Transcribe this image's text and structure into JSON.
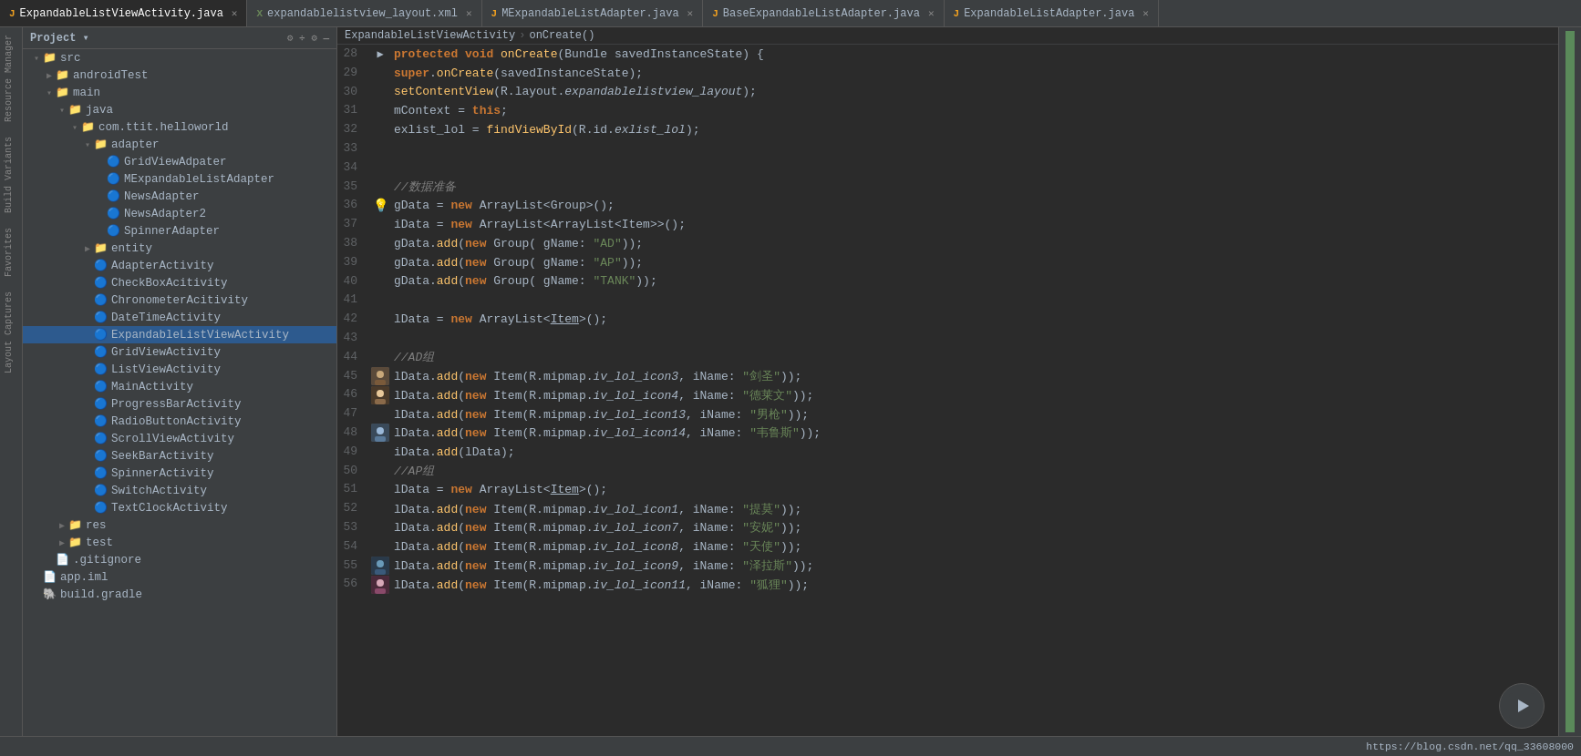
{
  "tabs": [
    {
      "id": "tab1",
      "label": "ExpandableListViewActivity.java",
      "type": "java",
      "active": true
    },
    {
      "id": "tab2",
      "label": "expandablelistview_layout.xml",
      "type": "xml",
      "active": false
    },
    {
      "id": "tab3",
      "label": "MExpandableListAdapter.java",
      "type": "java",
      "active": false
    },
    {
      "id": "tab4",
      "label": "BaseExpandableListAdapter.java",
      "type": "java",
      "active": false
    },
    {
      "id": "tab5",
      "label": "ExpandableListAdapter.java",
      "type": "java",
      "active": false
    }
  ],
  "sidebar": {
    "title": "Project",
    "items": [
      {
        "level": 1,
        "type": "folder",
        "label": "src",
        "expanded": true
      },
      {
        "level": 2,
        "type": "folder",
        "label": "androidTest",
        "expanded": false
      },
      {
        "level": 2,
        "type": "folder",
        "label": "main",
        "expanded": true
      },
      {
        "level": 3,
        "type": "folder",
        "label": "java",
        "expanded": true
      },
      {
        "level": 4,
        "type": "folder",
        "label": "com.ttit.helloworld",
        "expanded": true
      },
      {
        "level": 5,
        "type": "folder",
        "label": "adapter",
        "expanded": true
      },
      {
        "level": 6,
        "type": "java",
        "label": "GridViewAdpater"
      },
      {
        "level": 6,
        "type": "java",
        "label": "MExpandableListAdapter"
      },
      {
        "level": 6,
        "type": "java",
        "label": "NewsAdapter"
      },
      {
        "level": 6,
        "type": "java",
        "label": "NewsAdapter2"
      },
      {
        "level": 6,
        "type": "java",
        "label": "SpinnerAdapter"
      },
      {
        "level": 5,
        "type": "folder",
        "label": "entity",
        "expanded": false
      },
      {
        "level": 5,
        "type": "java",
        "label": "AdapterActivity"
      },
      {
        "level": 5,
        "type": "java",
        "label": "CheckBoxAcitivity"
      },
      {
        "level": 5,
        "type": "java",
        "label": "ChronometerAcitivity"
      },
      {
        "level": 5,
        "type": "java",
        "label": "DateTimeActivity"
      },
      {
        "level": 5,
        "type": "java",
        "label": "ExpandableListViewActivity",
        "selected": true
      },
      {
        "level": 5,
        "type": "java",
        "label": "GridViewActivity"
      },
      {
        "level": 5,
        "type": "java",
        "label": "ListViewActivity"
      },
      {
        "level": 5,
        "type": "java",
        "label": "MainActivity"
      },
      {
        "level": 5,
        "type": "java",
        "label": "ProgressBarActivity"
      },
      {
        "level": 5,
        "type": "java",
        "label": "RadioButtonActivity"
      },
      {
        "level": 5,
        "type": "java",
        "label": "ScrollViewActivity"
      },
      {
        "level": 5,
        "type": "java",
        "label": "SeekBarActivity"
      },
      {
        "level": 5,
        "type": "java",
        "label": "SpinnerActivity"
      },
      {
        "level": 5,
        "type": "java",
        "label": "SwitchActivity"
      },
      {
        "level": 5,
        "type": "java",
        "label": "TextClockActivity"
      },
      {
        "level": 3,
        "type": "folder",
        "label": "res",
        "expanded": false
      },
      {
        "level": 3,
        "type": "folder",
        "label": "test",
        "expanded": false
      },
      {
        "level": 2,
        "type": "git",
        "label": ".gitignore"
      },
      {
        "level": 1,
        "type": "iml",
        "label": "app.iml"
      },
      {
        "level": 1,
        "type": "gradle",
        "label": "build.gradle"
      }
    ]
  },
  "code": {
    "lines": [
      {
        "num": 28,
        "content": "protected",
        "raw": "    <kw>protected</kw> <kw>void</kw> <method>onCreate</method>(<type>Bundle</type> <param>savedInstanceState</param>) {",
        "gutter": "arrow"
      },
      {
        "num": 29,
        "content": "",
        "raw": "        <kw>super</kw>.<method>onCreate</method>(<param>savedInstanceState</param>);"
      },
      {
        "num": 30,
        "content": "",
        "raw": "        <method>setContentView</method>(<type>R</type>.layout.<italic-type>expandablelistview_layout</italic-type>);"
      },
      {
        "num": 31,
        "content": "",
        "raw": "        mContext = <kw>this</kw>;"
      },
      {
        "num": 32,
        "content": "",
        "raw": "        exlist_lol = <method>findViewById</method>(<type>R</type>.id.<italic-type>exlist_lol</italic-type>);"
      },
      {
        "num": 33,
        "content": "",
        "raw": ""
      },
      {
        "num": 34,
        "content": "",
        "raw": ""
      },
      {
        "num": 35,
        "content": "",
        "raw": "        <comment>//数据准备</comment>"
      },
      {
        "num": 36,
        "content": "",
        "raw": "        gData = <kw>new</kw> <type>ArrayList</type>&lt;<type>Group</type>&gt;();",
        "gutter": "bulb"
      },
      {
        "num": 37,
        "content": "",
        "raw": "        iData = <kw>new</kw> <type>ArrayList</type>&lt;<type>ArrayList</type>&lt;<type>Item</type>&gt;&gt;();"
      },
      {
        "num": 38,
        "content": "",
        "raw": "        gData.<method>add</method>(<kw>new</kw> <type>Group</type>( gName: <string>\"AD\"</string>));"
      },
      {
        "num": 39,
        "content": "",
        "raw": "        gData.<method>add</method>(<kw>new</kw> <type>Group</type>( gName: <string>\"AP\"</string>));"
      },
      {
        "num": 40,
        "content": "",
        "raw": "        gData.<method>add</method>(<kw>new</kw> <type>Group</type>( gName: <string>\"TANK\"</string>));"
      },
      {
        "num": 41,
        "content": "",
        "raw": ""
      },
      {
        "num": 42,
        "content": "",
        "raw": "        lData = <kw>new</kw> <type>ArrayList</type>&lt;<type>Item</type>&gt;();"
      },
      {
        "num": 43,
        "content": "",
        "raw": ""
      },
      {
        "num": 44,
        "content": "",
        "raw": "        <comment>//AD组</comment>"
      },
      {
        "num": 45,
        "content": "",
        "raw": "        lData.<method>add</method>(<kw>new</kw> <type>Item</type>(<type>R</type>.mipmap.<italic-type>iv_lol_icon3</italic-type>,  iName: <string>\"剑圣\"</string>));",
        "gutter": "thumb"
      },
      {
        "num": 46,
        "content": "",
        "raw": "        lData.<method>add</method>(<kw>new</kw> <type>Item</type>(<type>R</type>.mipmap.<italic-type>iv_lol_icon4</italic-type>,  iName: <string>\"德莱文\"</string>));",
        "gutter": "thumb"
      },
      {
        "num": 47,
        "content": "",
        "raw": "        lData.<method>add</method>(<kw>new</kw> <type>Item</type>(<type>R</type>.mipmap.<italic-type>iv_lol_icon13</italic-type>,  iName: <string>\"男枪\"</string>));"
      },
      {
        "num": 48,
        "content": "",
        "raw": "        lData.<method>add</method>(<kw>new</kw> <type>Item</type>(<type>R</type>.mipmap.<italic-type>iv_lol_icon14</italic-type>,  iName: <string>\"韦鲁斯\"</string>));",
        "gutter": "thumb"
      },
      {
        "num": 49,
        "content": "",
        "raw": "        iData.<method>add</method>(lData);"
      },
      {
        "num": 50,
        "content": "",
        "raw": "        <comment>//AP组</comment>"
      },
      {
        "num": 51,
        "content": "",
        "raw": "        lData = <kw>new</kw> <type>ArrayList</type>&lt;<type>Item</type>&gt;();"
      },
      {
        "num": 52,
        "content": "",
        "raw": "        lData.<method>add</method>(<kw>new</kw> <type>Item</type>(<type>R</type>.mipmap.<italic-type>iv_lol_icon1</italic-type>,  iName: <string>\"提莫\"</string>));"
      },
      {
        "num": 53,
        "content": "",
        "raw": "        lData.<method>add</method>(<kw>new</kw> <type>Item</type>(<type>R</type>.mipmap.<italic-type>iv_lol_icon7</italic-type>,  iName: <string>\"安妮\"</string>));"
      },
      {
        "num": 54,
        "content": "",
        "raw": "        lData.<method>add</kw>(<kw>new</kw> <type>Item</type>(<type>R</type>.mipmap.<italic-type>iv_lol_icon8</italic-type>,  iName: <string>\"天使\"</string>));"
      },
      {
        "num": 55,
        "content": "",
        "raw": "        lData.<method>add</method>(<kw>new</kw> <type>Item</type>(<type>R</type>.mipmap.<italic-type>iv_lol_icon9</italic-type>,  iName: <string>\"泽拉斯\"</string>));",
        "gutter": "thumb"
      },
      {
        "num": 56,
        "content": "",
        "raw": "        lData.<method>add</method>(<kw>new</kw> <type>Item</type>(<type>R</type>.mipmap.<italic-type>iv_lol_icon11</italic-type>, iName: <string>\"狐狸\"</string>));",
        "gutter": "thumb"
      }
    ]
  },
  "breadcrumb": {
    "file": "ExpandableListViewActivity",
    "method": "onCreate()"
  },
  "status": {
    "url": "https://blog.csdn.net/qq_33608000"
  },
  "toolbar": {
    "title": "Project"
  }
}
